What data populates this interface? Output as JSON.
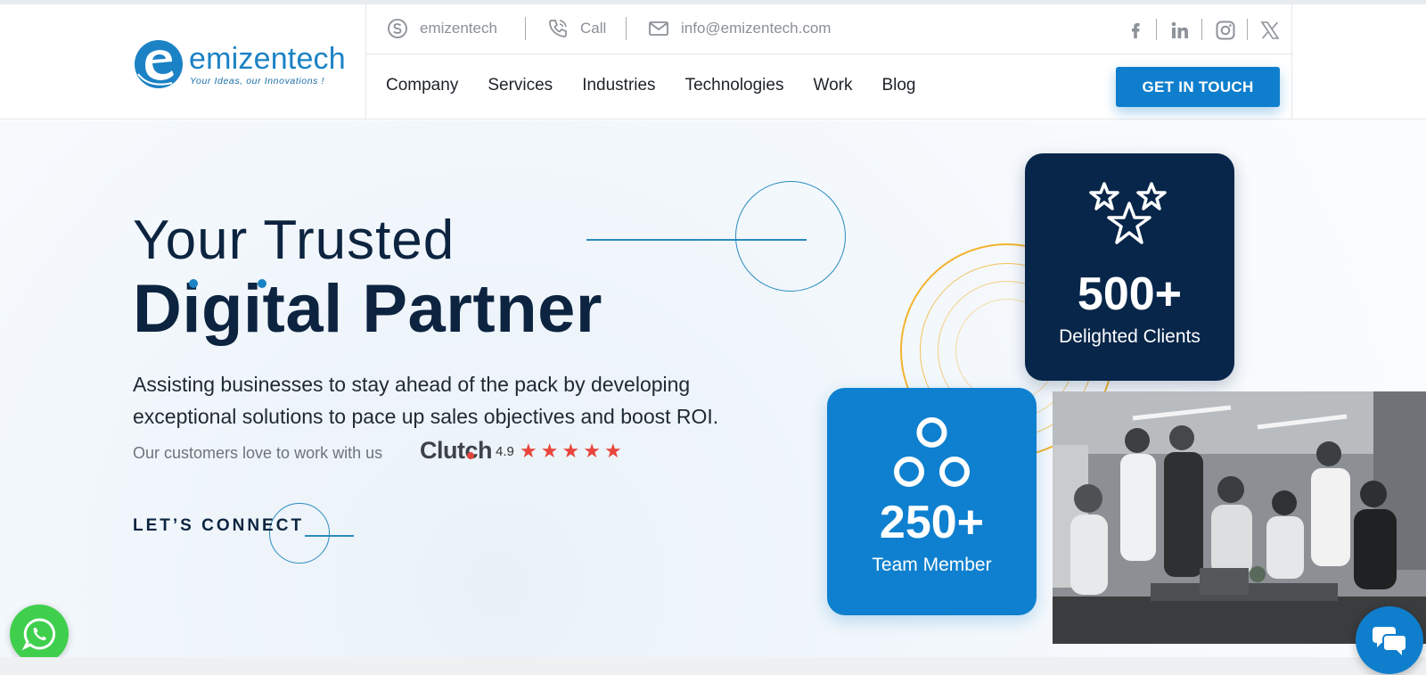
{
  "brand": {
    "name": "emizentech",
    "tagline": "Your Ideas, our Innovations !",
    "color": "#1b82c5"
  },
  "contact_bar": {
    "skype": "emizentech",
    "call": "Call",
    "email": "info@emizentech.com"
  },
  "social": [
    "facebook-icon",
    "linkedin-icon",
    "instagram-icon",
    "x-icon"
  ],
  "nav": {
    "items": [
      "Company",
      "Services",
      "Industries",
      "Technologies",
      "Work",
      "Blog"
    ],
    "cta": "GET IN TOUCH"
  },
  "hero": {
    "title_line1": "Your Trusted",
    "title_line2": "Digital Partner",
    "subtitle": "Assisting businesses to stay ahead of the pack by developing exceptional solutions to pace up sales objectives and boost ROI.",
    "reviews_text": "Our customers love to work with us",
    "review_brand": "Clutch",
    "rating": "4.9",
    "stars": 5,
    "connect_label": "LET’S CONNECT"
  },
  "stats": {
    "clients": {
      "value": "500+",
      "label": "Delighted Clients"
    },
    "team": {
      "value": "250+",
      "label": "Team Member"
    }
  },
  "colors": {
    "navy": "#0d2440",
    "card_dark": "#08264a",
    "card_blue": "#0f80cf",
    "cta_blue": "#0f7fcd",
    "star_red": "#e8453c",
    "ring_gold": "#f3b32e",
    "whatsapp_green": "#3fcf4d"
  },
  "floating": {
    "whatsapp": "whatsapp-icon",
    "chat": "chat-icon"
  }
}
